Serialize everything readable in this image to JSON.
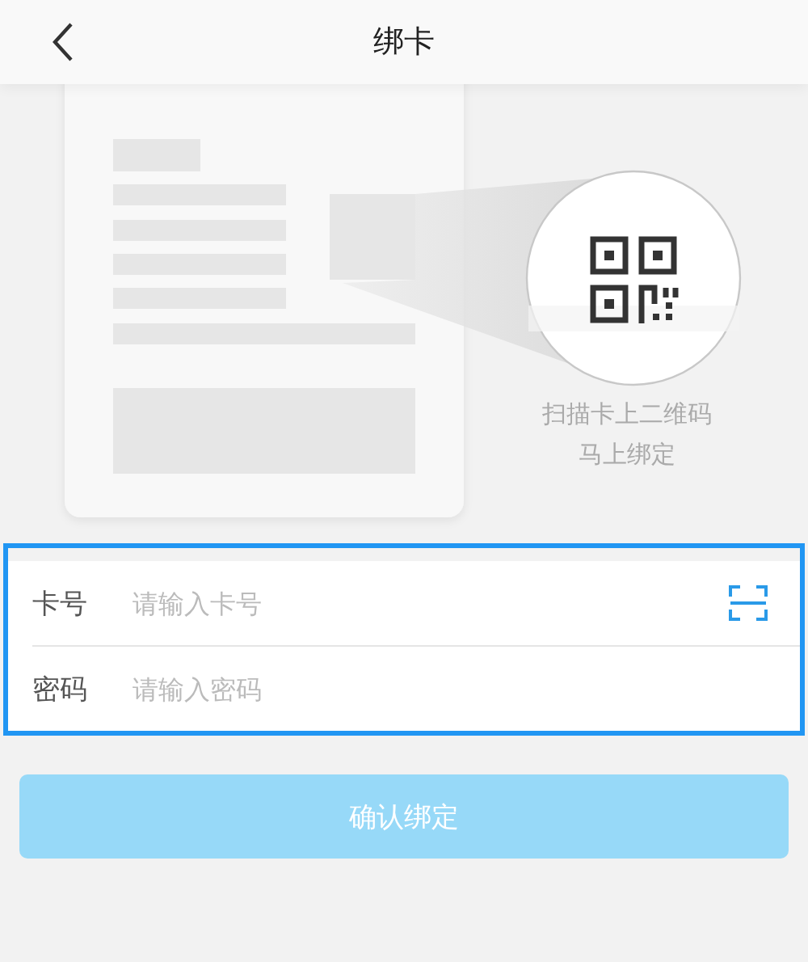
{
  "header": {
    "title": "绑卡"
  },
  "illustration": {
    "caption_lines": [
      "扫描卡上二维码",
      "马上绑定"
    ]
  },
  "form": {
    "highlighted": true,
    "fields": [
      {
        "label": "卡号",
        "placeholder": "请输入卡号",
        "kind": "scan"
      },
      {
        "label": "密码",
        "placeholder": "请输入密码",
        "kind": "password"
      }
    ]
  },
  "submit_button": {
    "label": "确认绑定",
    "disabled": true
  }
}
